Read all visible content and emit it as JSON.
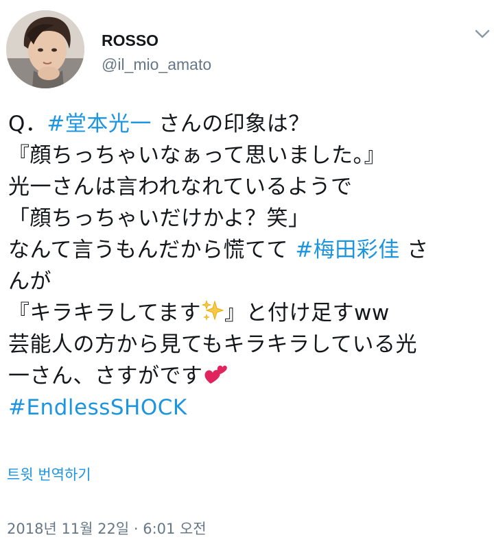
{
  "user": {
    "name": "ROSSO",
    "handle": "@il_mio_amato",
    "avatar_icon": "user-avatar"
  },
  "menu": {
    "icon": "chevron-down-icon"
  },
  "tweet": {
    "line1_prefix": "Q．",
    "line1_hashtag": "#堂本光一",
    "line1_suffix": " さんの印象は？",
    "line2": "『顔ちっちゃいなぁって思いました。』",
    "line3": "光一さんは言われなれているようで",
    "line4": "「顔ちっちゃいだけかよ？笑」",
    "line5_prefix": "なんて言うもんだから慌てて ",
    "line5_hashtag": "#梅田彩佳",
    "line5_suffix": " さ",
    "line6": "んが",
    "line7_prefix": "『キラキラしてます",
    "line7_suffix": "』と付け足すww",
    "line8": "芸能人の方から見てもキラキラしている光",
    "line9": "一さん、さすがです",
    "line10_hashtag": "#EndlessSHOCK",
    "emoji_sparkles": "sparkles-icon",
    "emoji_hearts": "two-hearts-icon"
  },
  "translate_label": "트윗 번역하기",
  "timestamp": "2018년 11월 22일 · 6:01 오전",
  "colors": {
    "link": "#1b95e0",
    "text": "#14171a",
    "muted": "#657786"
  }
}
